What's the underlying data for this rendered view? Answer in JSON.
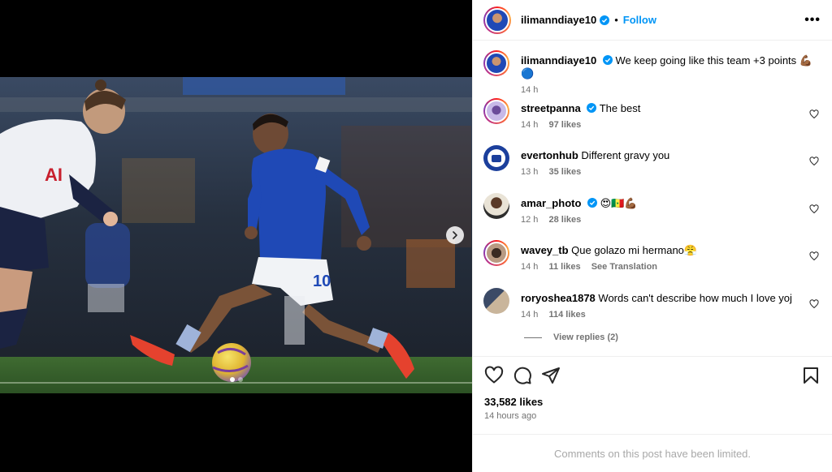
{
  "post": {
    "username": "ilimanndiaye10",
    "follow_label": "Follow",
    "separator": "•",
    "more_label": "•••"
  },
  "caption": {
    "username": "ilimanndiaye10",
    "text": "We keep going like this team +3 points 💪🏾🔵",
    "time": "14 h"
  },
  "comments": [
    {
      "username": "streetpanna",
      "verified": true,
      "text": "The best",
      "time": "14 h",
      "likes": "97 likes",
      "extra": ""
    },
    {
      "username": "evertonhub",
      "verified": false,
      "text": "Different gravy you",
      "time": "13 h",
      "likes": "35 likes",
      "extra": ""
    },
    {
      "username": "amar_photo",
      "verified": true,
      "text": "😍🇸🇳💪🏾",
      "time": "12 h",
      "likes": "28 likes",
      "extra": ""
    },
    {
      "username": "wavey_tb",
      "verified": false,
      "text": "Que golazo mi hermano😤",
      "time": "14 h",
      "likes": "11 likes",
      "extra": "See Translation"
    },
    {
      "username": "roryoshea1878",
      "verified": false,
      "text": "Words can't describe how much I love yoj",
      "time": "14 h",
      "likes": "114 likes",
      "extra": ""
    }
  ],
  "view_replies": "View replies (2)",
  "stats": {
    "likes": "33,582 likes",
    "ago": "14 hours ago"
  },
  "limited_notice": "Comments on this post have been limited.",
  "colors": {
    "accent": "#0095f6",
    "verified": "#0095f6",
    "muted": "#737373",
    "everton_blue": "#1b3f9c"
  },
  "icons": [
    "heart-icon",
    "comment-icon",
    "share-icon",
    "bookmark-icon",
    "verified-icon",
    "chevron-right-icon",
    "more-icon"
  ]
}
